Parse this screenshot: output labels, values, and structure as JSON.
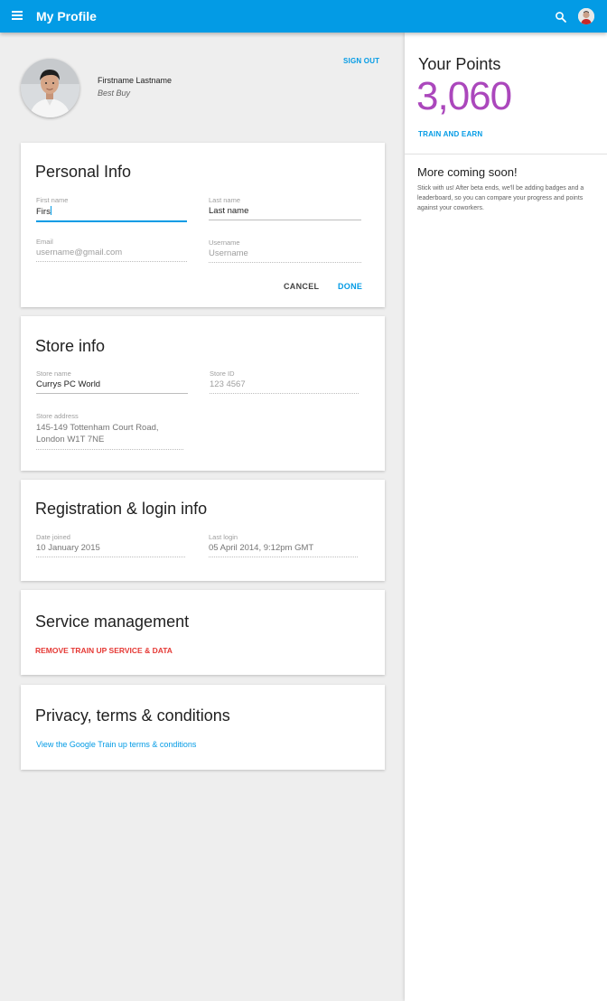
{
  "appbar": {
    "title": "My Profile",
    "menu_icon": "hamburger-menu-icon",
    "search_icon": "search-icon",
    "accent_color": "#039be5"
  },
  "profile": {
    "name": "Firstname Lastname",
    "store": "Best Buy",
    "sign_out_label": "SIGN OUT"
  },
  "personal_info": {
    "title": "Personal Info",
    "first_name": {
      "label": "First name",
      "value": "Firs"
    },
    "last_name": {
      "label": "Last name",
      "value": "Last name"
    },
    "email": {
      "label": "Email",
      "value": "username@gmail.com"
    },
    "username": {
      "label": "Username",
      "value": "Username"
    },
    "cancel_label": "CANCEL",
    "done_label": "DONE"
  },
  "store_info": {
    "title": "Store info",
    "store_name": {
      "label": "Store name",
      "value": "Currys PC World"
    },
    "store_id": {
      "label": "Store ID",
      "value": "123 4567"
    },
    "store_address": {
      "label": "Store address",
      "line1": "145-149 Tottenham Court Road,",
      "line2": "London W1T 7NE"
    }
  },
  "registration": {
    "title": "Registration & login info",
    "date_joined": {
      "label": "Date joined",
      "value": "10 January 2015"
    },
    "last_login": {
      "label": "Last login",
      "value": "05 April 2014, 9:12pm GMT"
    }
  },
  "service": {
    "title": "Service management",
    "remove_label": "REMOVE TRAIN UP SERVICE & DATA",
    "danger_color": "#e53935"
  },
  "privacy": {
    "title": "Privacy, terms & conditions",
    "terms_link": "View the Google Train up terms & conditions"
  },
  "points": {
    "title": "Your Points",
    "value": "3,060",
    "value_color": "#ab47bc",
    "train_label": "TRAIN AND EARN",
    "coming_title": "More coming soon!",
    "coming_text": "Stick with us! After beta ends, we'll be adding badges and a leaderboard, so you can compare your progress and points against your coworkers."
  }
}
